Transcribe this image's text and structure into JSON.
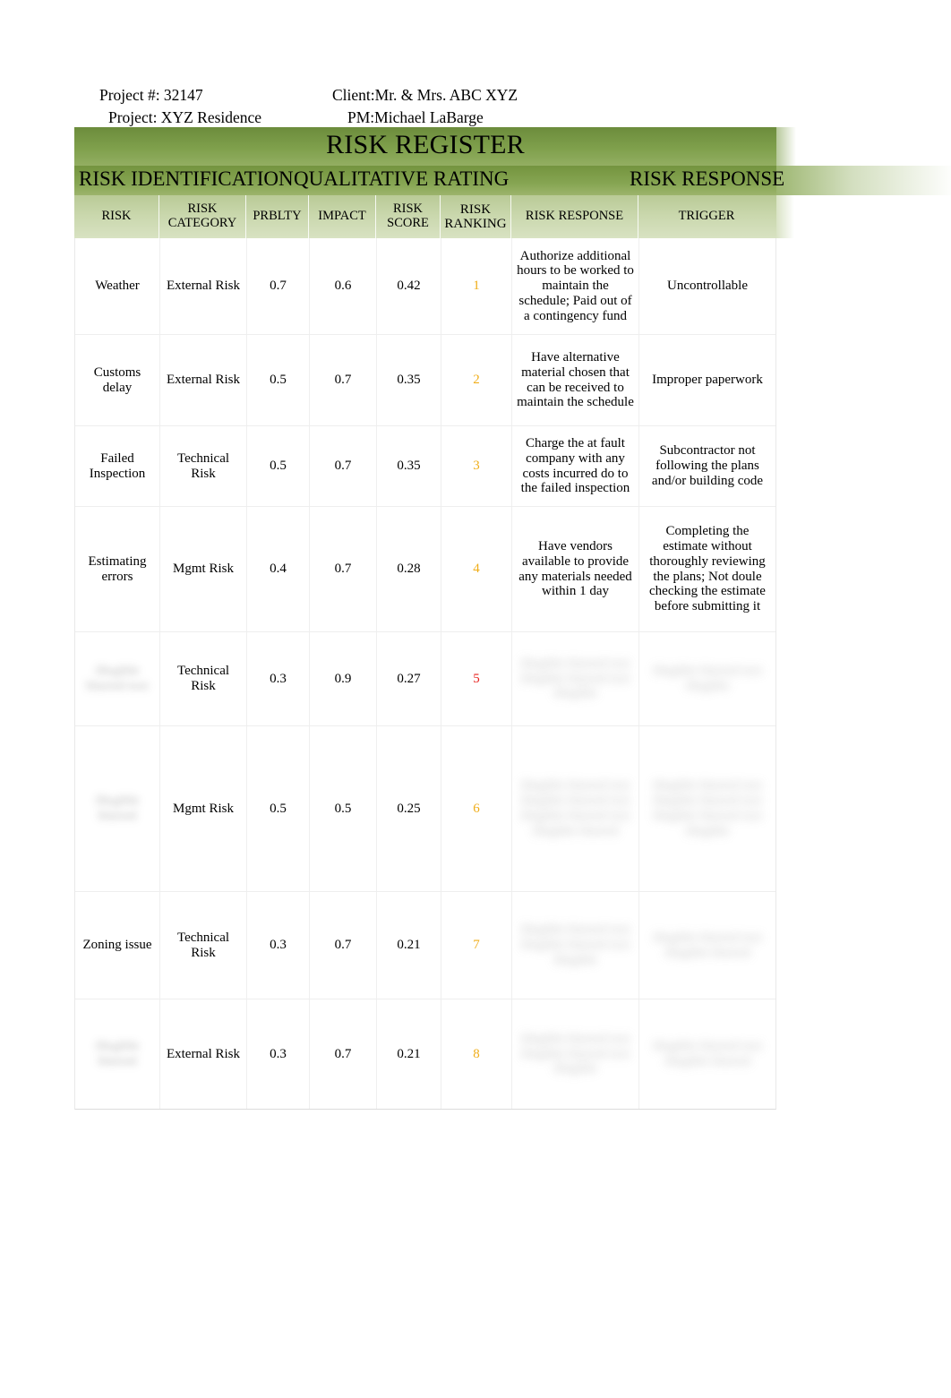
{
  "meta": {
    "project_number_label": "Project #: 32147",
    "client_label": "Client:Mr. & Mrs. ABC XYZ",
    "project_name_label": "Project: XYZ Residence",
    "pm_label": "PM:Michael LaBarge"
  },
  "title": "RISK REGISTER",
  "sections": {
    "identification": "RISK IDENTIFICATION",
    "qualitative": "QUALITATIVE RATING",
    "response": "RISK RESPONSE"
  },
  "columns": [
    "RISK",
    "RISK CATEGORY",
    "PRBLTY",
    "IMPACT",
    "RISK SCORE",
    "RISK RANKING",
    "RISK RESPONSE",
    "TRIGGER"
  ],
  "colors": {
    "band_dark_green": "#6c8c3c",
    "band_mid_green": "#86a552",
    "colhead_green": "#c9d7ac",
    "rank_amber": "#f0ad18",
    "rank_red": "#e8221e"
  },
  "rows": [
    {
      "risk": "Weather",
      "risk_blurred": false,
      "category": "External Risk",
      "probability": "0.7",
      "impact": "0.6",
      "score": "0.42",
      "ranking": "1",
      "ranking_color": "amber",
      "response": "Authorize additional hours to be worked to maintain the schedule; Paid out of a contingency fund",
      "response_blurred": false,
      "trigger": "Uncontrollable",
      "trigger_blurred": false
    },
    {
      "risk": "Customs delay",
      "risk_blurred": false,
      "category": "External Risk",
      "probability": "0.5",
      "impact": "0.7",
      "score": "0.35",
      "ranking": "2",
      "ranking_color": "amber",
      "response": "Have alternative material chosen that can be received to maintain the schedule",
      "response_blurred": false,
      "trigger": "Improper paperwork",
      "trigger_blurred": false
    },
    {
      "risk": "Failed Inspection",
      "risk_blurred": false,
      "category": "Technical Risk",
      "probability": "0.5",
      "impact": "0.7",
      "score": "0.35",
      "ranking": "3",
      "ranking_color": "amber",
      "response": "Charge the at fault company with any costs incurred do to the failed inspection",
      "response_blurred": false,
      "trigger": "Subcontractor not following the plans and/or building code",
      "trigger_blurred": false
    },
    {
      "risk": "Estimating errors",
      "risk_blurred": false,
      "category": "Mgmt Risk",
      "probability": "0.4",
      "impact": "0.7",
      "score": "0.28",
      "ranking": "4",
      "ranking_color": "amber",
      "response": "Have vendors available to provide any materials needed within 1 day",
      "response_blurred": false,
      "trigger": "Completing the estimate without thoroughly reviewing the plans; Not doule checking the estimate before submitting it",
      "trigger_blurred": false
    },
    {
      "risk": "illegible blurred text",
      "risk_blurred": true,
      "category": "Technical Risk",
      "probability": "0.3",
      "impact": "0.9",
      "score": "0.27",
      "ranking": "5",
      "ranking_color": "red",
      "response": "illegible blurred text illegible blurred text illegible",
      "response_blurred": true,
      "trigger": "illegible blurred text illegible",
      "trigger_blurred": true
    },
    {
      "risk": "illegible blurred",
      "risk_blurred": true,
      "category": "Mgmt Risk",
      "probability": "0.5",
      "impact": "0.5",
      "score": "0.25",
      "ranking": "6",
      "ranking_color": "amber",
      "response": "illegible blurred text illegible blurred text illegible blurred text illegible blurred",
      "response_blurred": true,
      "trigger": "illegible blurred text illegible blurred text illegible blurred text illegible",
      "trigger_blurred": true
    },
    {
      "risk": "Zoning issue",
      "risk_blurred": false,
      "category": "Technical Risk",
      "probability": "0.3",
      "impact": "0.7",
      "score": "0.21",
      "ranking": "7",
      "ranking_color": "amber",
      "response": "illegible blurred text illegible blurred text illegible",
      "response_blurred": true,
      "trigger": "illegible blurred text illegible blurred",
      "trigger_blurred": true
    },
    {
      "risk": "illegible blurred",
      "risk_blurred": true,
      "category": "External Risk",
      "probability": "0.3",
      "impact": "0.7",
      "score": "0.21",
      "ranking": "8",
      "ranking_color": "amber",
      "response": "illegible blurred text illegible blurred text illegible",
      "response_blurred": true,
      "trigger": "illegible blurred text illegible blurred",
      "trigger_blurred": true
    }
  ]
}
